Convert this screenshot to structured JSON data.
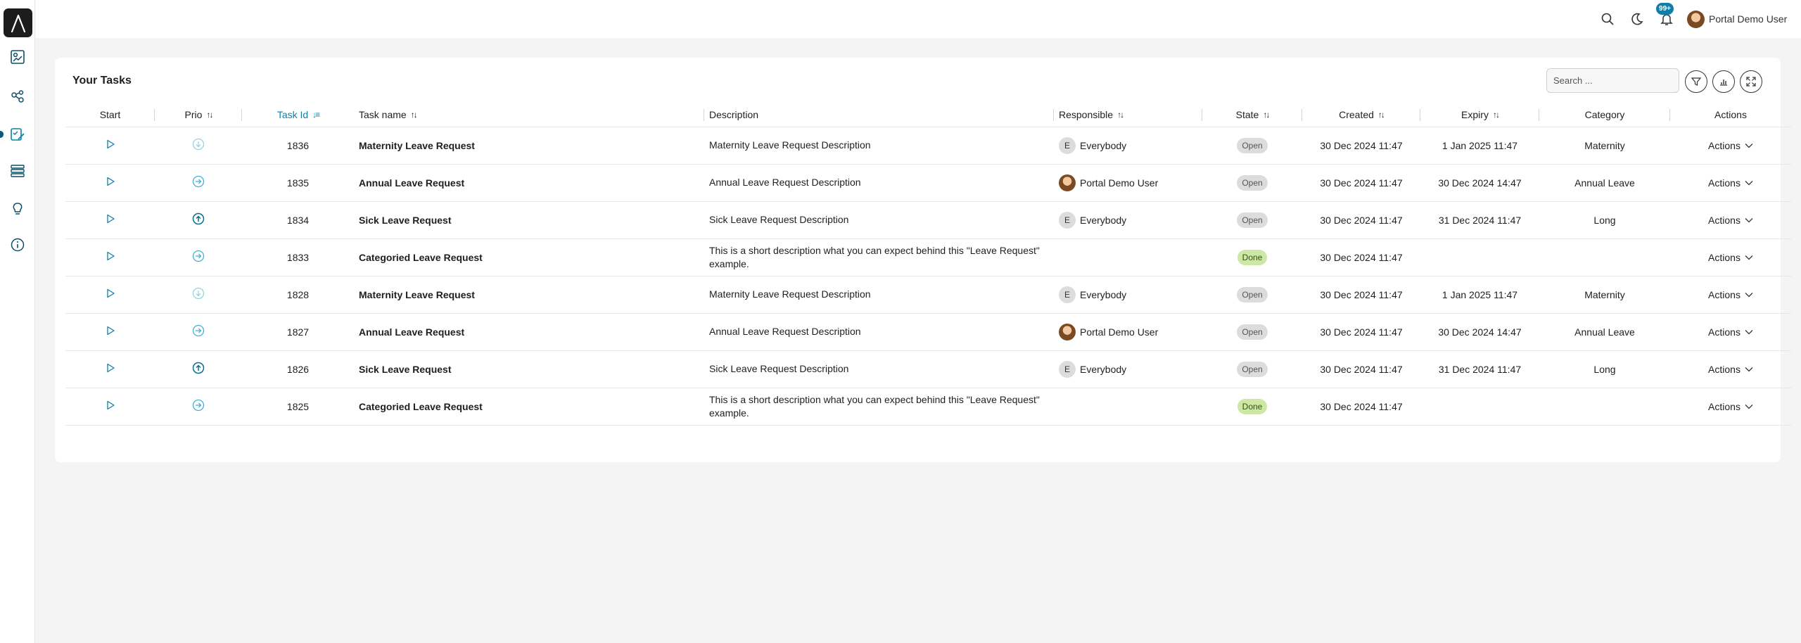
{
  "header": {
    "notification_badge": "99+",
    "user_name": "Portal Demo User",
    "icons": [
      "search-icon",
      "moon-icon",
      "bell-icon"
    ]
  },
  "sidebar": {
    "items": [
      {
        "icon": "dashboard-icon"
      },
      {
        "icon": "process-icon"
      },
      {
        "icon": "tasks-icon",
        "active": true
      },
      {
        "icon": "list-icon"
      },
      {
        "icon": "lightbulb-icon"
      },
      {
        "icon": "info-icon"
      }
    ]
  },
  "card": {
    "title": "Your Tasks",
    "search_placeholder": "Search ...",
    "buttons": [
      "filter-icon",
      "chart-icon",
      "expand-icon"
    ]
  },
  "columns": {
    "start": "Start",
    "prio": "Prio",
    "task_id": "Task Id",
    "task_name": "Task name",
    "description": "Description",
    "responsible": "Responsible",
    "state": "State",
    "created": "Created",
    "expiry": "Expiry",
    "category": "Category",
    "actions": "Actions"
  },
  "rows": [
    {
      "prio": "low",
      "id": "1836",
      "name": "Maternity Leave Request",
      "description": "Maternity Leave Request Description",
      "responsible": "Everybody",
      "responsible_initial": "E",
      "responsible_type": "group",
      "state": "Open",
      "created": "30 Dec 2024 11:47",
      "expiry": "1 Jan 2025 11:47",
      "category": "Maternity",
      "actions": "Actions"
    },
    {
      "prio": "normal",
      "id": "1835",
      "name": "Annual Leave Request",
      "description": "Annual Leave Request Description",
      "responsible": "Portal Demo User",
      "responsible_initial": "",
      "responsible_type": "user",
      "state": "Open",
      "created": "30 Dec 2024 11:47",
      "expiry": "30 Dec 2024 14:47",
      "category": "Annual Leave",
      "actions": "Actions"
    },
    {
      "prio": "high",
      "id": "1834",
      "name": "Sick Leave Request",
      "description": "Sick Leave Request Description",
      "responsible": "Everybody",
      "responsible_initial": "E",
      "responsible_type": "group",
      "state": "Open",
      "created": "30 Dec 2024 11:47",
      "expiry": "31 Dec 2024 11:47",
      "category": "Long",
      "actions": "Actions"
    },
    {
      "prio": "normal",
      "id": "1833",
      "name": "Categoried Leave Request",
      "description": "This is a short description what you can expect behind this \"Leave Request\" example.",
      "responsible": "",
      "responsible_initial": "",
      "responsible_type": "none",
      "state": "Done",
      "created": "30 Dec 2024 11:47",
      "expiry": "",
      "category": "",
      "actions": "Actions"
    },
    {
      "prio": "low",
      "id": "1828",
      "name": "Maternity Leave Request",
      "description": "Maternity Leave Request Description",
      "responsible": "Everybody",
      "responsible_initial": "E",
      "responsible_type": "group",
      "state": "Open",
      "created": "30 Dec 2024 11:47",
      "expiry": "1 Jan 2025 11:47",
      "category": "Maternity",
      "actions": "Actions"
    },
    {
      "prio": "normal",
      "id": "1827",
      "name": "Annual Leave Request",
      "description": "Annual Leave Request Description",
      "responsible": "Portal Demo User",
      "responsible_initial": "",
      "responsible_type": "user",
      "state": "Open",
      "created": "30 Dec 2024 11:47",
      "expiry": "30 Dec 2024 14:47",
      "category": "Annual Leave",
      "actions": "Actions"
    },
    {
      "prio": "high",
      "id": "1826",
      "name": "Sick Leave Request",
      "description": "Sick Leave Request Description",
      "responsible": "Everybody",
      "responsible_initial": "E",
      "responsible_type": "group",
      "state": "Open",
      "created": "30 Dec 2024 11:47",
      "expiry": "31 Dec 2024 11:47",
      "category": "Long",
      "actions": "Actions"
    },
    {
      "prio": "normal",
      "id": "1825",
      "name": "Categoried Leave Request",
      "description": "This is a short description what you can expect behind this \"Leave Request\" example.",
      "responsible": "",
      "responsible_initial": "",
      "responsible_type": "none",
      "state": "Done",
      "created": "30 Dec 2024 11:47",
      "expiry": "",
      "category": "",
      "actions": "Actions"
    }
  ],
  "colors": {
    "accent": "#0e7fa8",
    "sidebar_active": "#0b5c78",
    "prio_low": "#8fd0e6",
    "prio_normal": "#46aed3",
    "prio_high": "#0b6d91",
    "state_done": "#cde8a4"
  }
}
